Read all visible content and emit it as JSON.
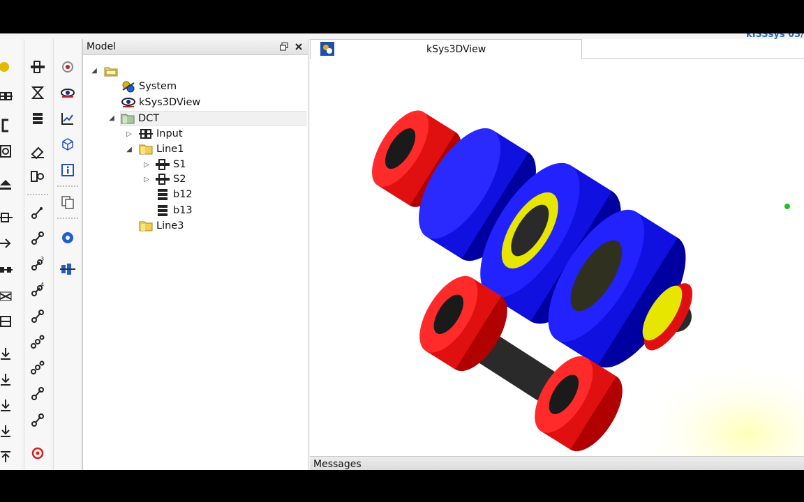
{
  "brand": {
    "text": "kISSsys 03/"
  },
  "model_panel": {
    "title": "Model",
    "float_icon": "float-window-icon",
    "close_icon": "close-icon"
  },
  "tree": {
    "root": {
      "icon": "folder-open-icon"
    },
    "system": {
      "label": "System",
      "icon": "system-icon"
    },
    "view3d": {
      "label": "kSys3DView",
      "icon": "eye-icon"
    },
    "dct": {
      "label": "DCT",
      "icon": "folder-icon"
    },
    "input": {
      "label": "Input",
      "icon": "coupling-icon"
    },
    "line1": {
      "label": "Line1",
      "icon": "folder-icon"
    },
    "s1": {
      "label": "S1",
      "icon": "shaft-icon"
    },
    "s2": {
      "label": "S2",
      "icon": "shaft-icon"
    },
    "b12": {
      "label": "b12",
      "icon": "bearing-icon"
    },
    "b13": {
      "label": "b13",
      "icon": "bearing-icon"
    },
    "line3": {
      "label": "Line3",
      "icon": "folder-icon"
    }
  },
  "view_tab": {
    "label": "kSys3DView",
    "icon": "3d-view-icon"
  },
  "messages": {
    "title": "Messages"
  },
  "colors": {
    "gear_blue": "#1010e0",
    "bearing_red": "#e01010",
    "shaft_dark": "#2a2a2a",
    "hub_yellow": "#e6e600",
    "brand_blue": "#2a6cc4"
  }
}
